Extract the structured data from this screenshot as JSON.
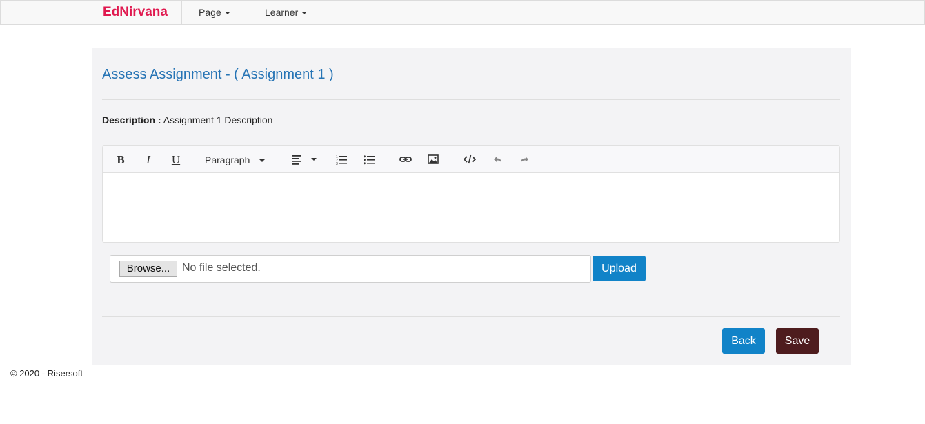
{
  "navbar": {
    "brand": "EdNirvana",
    "items": [
      {
        "label": "Page"
      },
      {
        "label": "Learner"
      }
    ]
  },
  "page": {
    "title": "Assess Assignment - ( Assignment 1 )",
    "description_label": "Description :",
    "description_value": "Assignment 1 Description"
  },
  "editor": {
    "block_format": "Paragraph",
    "tools": [
      "bold-icon",
      "italic-icon",
      "underline-icon",
      "align-left-icon",
      "ordered-list-icon",
      "unordered-list-icon",
      "link-icon",
      "image-icon",
      "code-icon",
      "undo-icon",
      "redo-icon"
    ],
    "content": ""
  },
  "upload": {
    "browse_label": "Browse...",
    "status": "No file selected.",
    "upload_label": "Upload"
  },
  "actions": {
    "back_label": "Back",
    "save_label": "Save"
  },
  "colors": {
    "brand": "#e0194f",
    "title": "#2674b5",
    "primary_button": "#1183c8",
    "save_button": "#4e1c1e"
  },
  "footer": {
    "copyright": "© 2020 - Risersoft"
  }
}
